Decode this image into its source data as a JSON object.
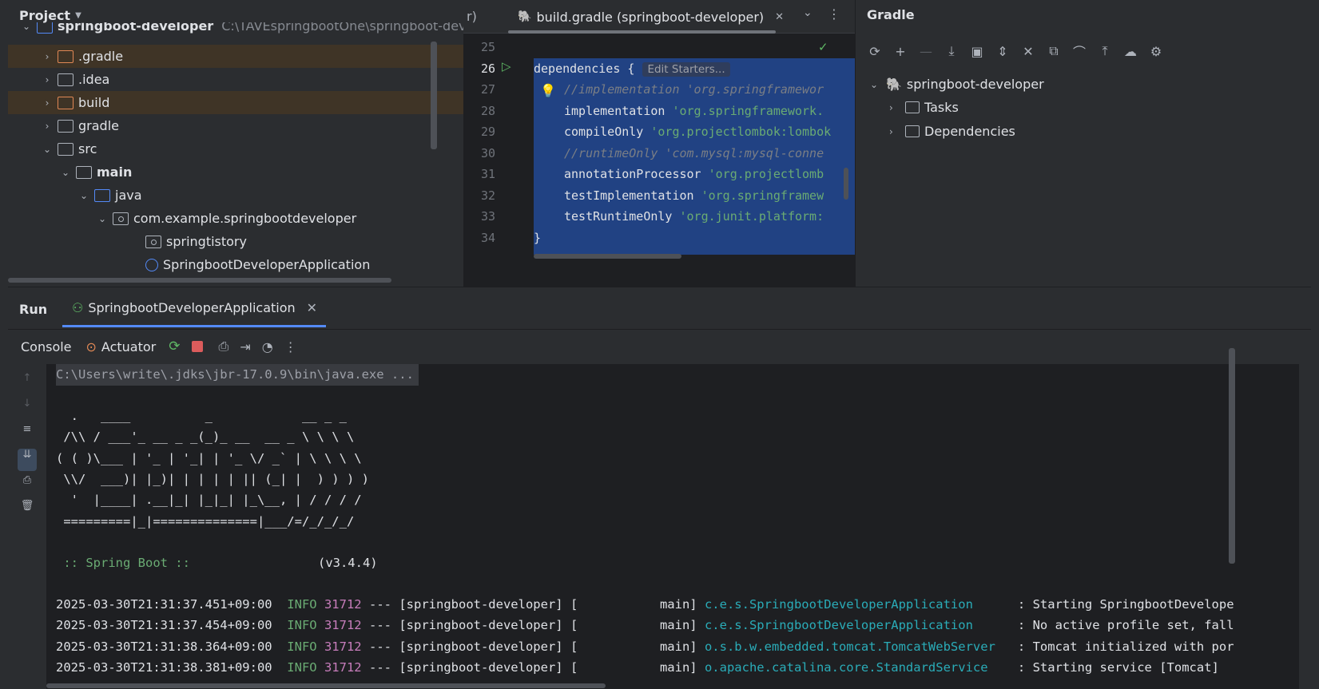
{
  "project": {
    "title": "Project",
    "root": {
      "name": "springboot-developer",
      "path": "C:\\TAVEspringbootOne\\springboot-deve"
    },
    "items": [
      {
        "name": ".gradle",
        "type": "folder-orange",
        "expanded": false,
        "highlight": true
      },
      {
        "name": ".idea",
        "type": "folder",
        "expanded": false,
        "highlight": false
      },
      {
        "name": "build",
        "type": "folder-orange",
        "expanded": false,
        "highlight": true
      },
      {
        "name": "gradle",
        "type": "folder",
        "expanded": false,
        "highlight": false
      },
      {
        "name": "src",
        "type": "folder",
        "expanded": true,
        "highlight": false
      },
      {
        "name": "main",
        "type": "folder",
        "expanded": true,
        "highlight": false
      },
      {
        "name": "java",
        "type": "folder-blue",
        "expanded": true,
        "highlight": false
      },
      {
        "name": "com.example.springbootdeveloper",
        "type": "package",
        "expanded": true,
        "highlight": false
      },
      {
        "name": "springtistory",
        "type": "package",
        "expanded": false,
        "highlight": false
      },
      {
        "name": "SpringbootDeveloperApplication",
        "type": "class",
        "expanded": false,
        "highlight": false
      }
    ]
  },
  "editor": {
    "prev_tab_fragment": "r)",
    "active_tab": "build.gradle (springboot-developer)",
    "inlay_hint": "Edit Starters...",
    "lines": [
      {
        "n": "25",
        "text": ""
      },
      {
        "n": "26",
        "text": "dependencies {"
      },
      {
        "n": "27",
        "text": "//implementation 'org.springframewor"
      },
      {
        "n": "28",
        "text": "implementation 'org.springframework."
      },
      {
        "n": "29",
        "text": "compileOnly 'org.projectlombok:lombok"
      },
      {
        "n": "30",
        "text": "//runtimeOnly 'com.mysql:mysql-conne"
      },
      {
        "n": "31",
        "text": "annotationProcessor 'org.projectlomb"
      },
      {
        "n": "32",
        "text": "testImplementation 'org.springframew"
      },
      {
        "n": "33",
        "text": "testRuntimeOnly 'org.junit.platform:"
      },
      {
        "n": "34",
        "text": "}"
      }
    ]
  },
  "gradle": {
    "title": "Gradle",
    "root": "springboot-developer",
    "children": [
      "Tasks",
      "Dependencies"
    ]
  },
  "run": {
    "title": "Run",
    "tab": "SpringbootDeveloperApplication",
    "subtabs": [
      "Console",
      "Actuator"
    ],
    "command": "C:\\Users\\write\\.jdks\\jbr-17.0.9\\bin\\java.exe ...",
    "banner": [
      "  .   ____          _            __ _ _",
      " /\\\\ / ___'_ __ _ _(_)_ __  __ _ \\ \\ \\ \\",
      "( ( )\\___ | '_ | '_| | '_ \\/ _` | \\ \\ \\ \\",
      " \\\\/  ___)| |_)| | | | | || (_| |  ) ) ) )",
      "  '  |____| .__|_| |_|_| |_\\__, | / / / /",
      " =========|_|==============|___/=/_/_/_/"
    ],
    "spring_boot_label": " :: Spring Boot ::",
    "spring_boot_version": "(v3.4.4)",
    "logs": [
      {
        "ts": "2025-03-30T21:31:37.451+09:00",
        "level": "INFO",
        "pid": "31712",
        "sep": "---",
        "app": "[springboot-developer] [",
        "thread": "main]",
        "logger": "c.e.s.SpringbootDeveloperApplication",
        "msg": ": Starting SpringbootDevelope"
      },
      {
        "ts": "2025-03-30T21:31:37.454+09:00",
        "level": "INFO",
        "pid": "31712",
        "sep": "---",
        "app": "[springboot-developer] [",
        "thread": "main]",
        "logger": "c.e.s.SpringbootDeveloperApplication",
        "msg": ": No active profile set, fall"
      },
      {
        "ts": "2025-03-30T21:31:38.364+09:00",
        "level": "INFO",
        "pid": "31712",
        "sep": "---",
        "app": "[springboot-developer] [",
        "thread": "main]",
        "logger": "o.s.b.w.embedded.tomcat.TomcatWebServer",
        "msg": ": Tomcat initialized with por"
      },
      {
        "ts": "2025-03-30T21:31:38.381+09:00",
        "level": "INFO",
        "pid": "31712",
        "sep": "---",
        "app": "[springboot-developer] [",
        "thread": "main]",
        "logger": "o.apache.catalina.core.StandardService",
        "msg": ": Starting service [Tomcat]"
      }
    ]
  },
  "colors": {
    "accent": "#548af7",
    "selection": "#214283",
    "string": "#6aab73",
    "stop": "#db5c5c"
  }
}
